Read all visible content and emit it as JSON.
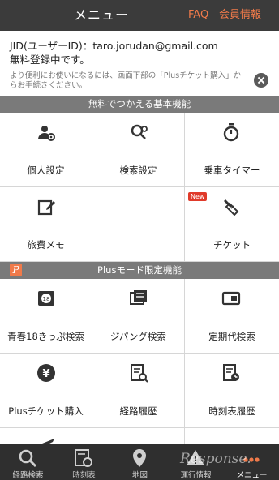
{
  "header": {
    "title": "メニュー",
    "faq": "FAQ",
    "account": "会員情報"
  },
  "user": {
    "id_line": "JID(ユーザーID)：taro.jorudan@gmail.com",
    "status": "無料登録中です。"
  },
  "notice": {
    "text": "より便利にお使いになるには、画面下部の「Plusチケット購入」からお手続きください。"
  },
  "free_section": {
    "title": "無料でつかえる基本機能",
    "items": [
      {
        "label": "個人設定",
        "icon": "gear-person-icon"
      },
      {
        "label": "検索設定",
        "icon": "gear-search-icon"
      },
      {
        "label": "乗車タイマー",
        "icon": "stopwatch-icon"
      },
      {
        "label": "旅費メモ",
        "icon": "edit-note-icon"
      },
      {
        "label": "",
        "icon": ""
      },
      {
        "label": "チケット",
        "icon": "ticket-icon",
        "badge": "New"
      }
    ]
  },
  "plus_section": {
    "badge": "P",
    "title": "Plusモード限定機能",
    "items": [
      {
        "label": "青春18きっぷ検索",
        "icon": "ticket-18-icon"
      },
      {
        "label": "ジパング検索",
        "icon": "pass-card-icon"
      },
      {
        "label": "定期代検索",
        "icon": "commuter-pass-icon"
      },
      {
        "label": "Plusチケット購入",
        "icon": "yen-coin-icon"
      },
      {
        "label": "経路履歴",
        "icon": "route-history-icon"
      },
      {
        "label": "時刻表履歴",
        "icon": "timetable-history-icon"
      },
      {
        "label": "",
        "icon": "airplane-icon"
      },
      {
        "label": "",
        "icon": ""
      },
      {
        "label": "",
        "icon": ""
      }
    ]
  },
  "tabbar": {
    "items": [
      {
        "label": "経路検索",
        "icon": "search-icon"
      },
      {
        "label": "時刻表",
        "icon": "timetable-icon"
      },
      {
        "label": "地図",
        "icon": "map-pin-icon"
      },
      {
        "label": "運行情報",
        "icon": "warning-icon"
      },
      {
        "label": "メニュー",
        "icon": "more-dots-icon",
        "active": true
      }
    ]
  },
  "watermark": "Response.",
  "colors": {
    "header_bg": "#3b3b3b",
    "accent": "#f07a4a",
    "section_bg": "#7a7a7a",
    "tabbar_bg": "#2f2f2f",
    "new_badge": "#e03a2a"
  }
}
